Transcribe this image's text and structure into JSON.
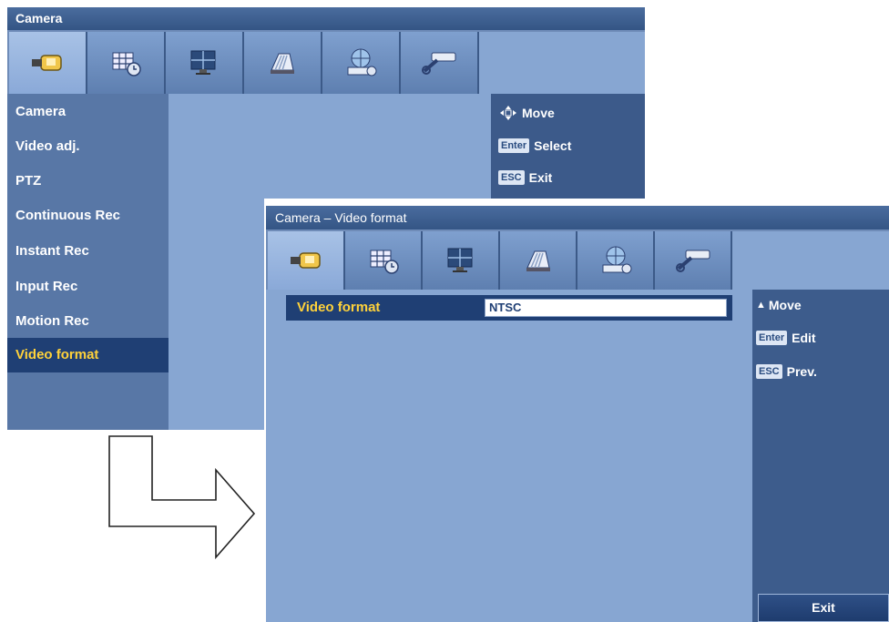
{
  "back_window": {
    "title": "Camera",
    "menu": [
      {
        "label": "Camera",
        "selected": false
      },
      {
        "label": "Video adj.",
        "selected": false
      },
      {
        "label": "PTZ",
        "selected": false
      },
      {
        "label": "Continuous Rec",
        "selected": false
      },
      {
        "label": "Instant Rec",
        "selected": false
      },
      {
        "label": "Input Rec",
        "selected": false
      },
      {
        "label": "Motion Rec",
        "selected": false
      },
      {
        "label": "Video format",
        "selected": true
      }
    ],
    "help": {
      "move": "Move",
      "enter_key": "Enter",
      "enter_action": "Select",
      "esc_key": "ESC",
      "esc_action": "Exit"
    }
  },
  "front_window": {
    "title": "Camera – Video format",
    "field": {
      "label": "Video format",
      "value": "NTSC"
    },
    "help": {
      "move": "Move",
      "enter_key": "Enter",
      "enter_action": "Edit",
      "esc_key": "ESC",
      "esc_action": "Prev."
    },
    "exit_button": "Exit"
  },
  "tabs": [
    {
      "icon": "camera-icon",
      "active": true
    },
    {
      "icon": "schedule-icon",
      "active": false
    },
    {
      "icon": "monitor-icon",
      "active": false
    },
    {
      "icon": "storage-icon",
      "active": false
    },
    {
      "icon": "network-icon",
      "active": false
    },
    {
      "icon": "tools-icon",
      "active": false
    }
  ],
  "colors": {
    "panel": "#87a6d2",
    "selected_bg": "#1f3f74",
    "selected_text": "#ffd23a",
    "title_bar": "#3a5b8c"
  }
}
